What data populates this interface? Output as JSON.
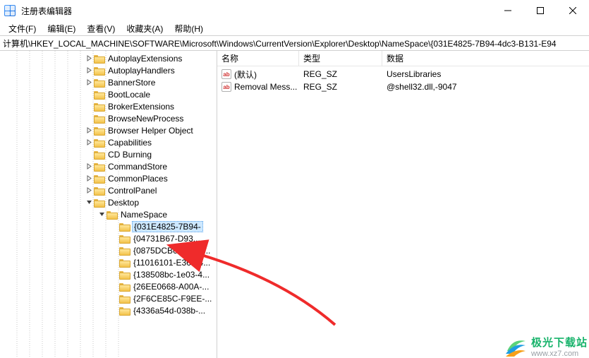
{
  "window": {
    "title": "注册表编辑器"
  },
  "menu": {
    "file": "文件(F)",
    "edit": "编辑(E)",
    "view": "查看(V)",
    "favorites": "收藏夹(A)",
    "help": "帮助(H)"
  },
  "address": "计算机\\HKEY_LOCAL_MACHINE\\SOFTWARE\\Microsoft\\Windows\\CurrentVersion\\Explorer\\Desktop\\NameSpace\\{031E4825-7B94-4dc3-B131-E94",
  "tree": {
    "items": [
      {
        "indent": 120,
        "chev": "right",
        "label": "AutoplayExtensions"
      },
      {
        "indent": 120,
        "chev": "right",
        "label": "AutoplayHandlers"
      },
      {
        "indent": 120,
        "chev": "right",
        "label": "BannerStore"
      },
      {
        "indent": 120,
        "chev": "none",
        "label": "BootLocale"
      },
      {
        "indent": 120,
        "chev": "none",
        "label": "BrokerExtensions"
      },
      {
        "indent": 120,
        "chev": "none",
        "label": "BrowseNewProcess"
      },
      {
        "indent": 120,
        "chev": "right",
        "label": "Browser Helper Object"
      },
      {
        "indent": 120,
        "chev": "right",
        "label": "Capabilities"
      },
      {
        "indent": 120,
        "chev": "none",
        "label": "CD Burning"
      },
      {
        "indent": 120,
        "chev": "right",
        "label": "CommandStore"
      },
      {
        "indent": 120,
        "chev": "right",
        "label": "CommonPlaces"
      },
      {
        "indent": 120,
        "chev": "right",
        "label": "ControlPanel"
      },
      {
        "indent": 120,
        "chev": "down",
        "label": "Desktop"
      },
      {
        "indent": 138,
        "chev": "down",
        "label": "NameSpace"
      },
      {
        "indent": 156,
        "chev": "none",
        "label": "{031E4825-7B94-",
        "selected": true
      },
      {
        "indent": 156,
        "chev": "none",
        "label": "{04731B67-D93..."
      },
      {
        "indent": 156,
        "chev": "none",
        "label": "{0875DCB6-C686-..."
      },
      {
        "indent": 156,
        "chev": "none",
        "label": "{11016101-E366-4..."
      },
      {
        "indent": 156,
        "chev": "none",
        "label": "{138508bc-1e03-4..."
      },
      {
        "indent": 156,
        "chev": "none",
        "label": "{26EE0668-A00A-..."
      },
      {
        "indent": 156,
        "chev": "none",
        "label": "{2F6CE85C-F9EE-..."
      },
      {
        "indent": 156,
        "chev": "none",
        "label": "{4336a54d-038b-..."
      }
    ]
  },
  "list": {
    "headers": {
      "name": "名称",
      "type": "类型",
      "data": "数据"
    },
    "rows": [
      {
        "name": "(默认)",
        "type": "REG_SZ",
        "data": "UsersLibraries"
      },
      {
        "name": "Removal Mess...",
        "type": "REG_SZ",
        "data": "@shell32.dll,-9047"
      }
    ]
  },
  "watermark": {
    "name": "极光下载站",
    "url": "www.xz7.com"
  }
}
